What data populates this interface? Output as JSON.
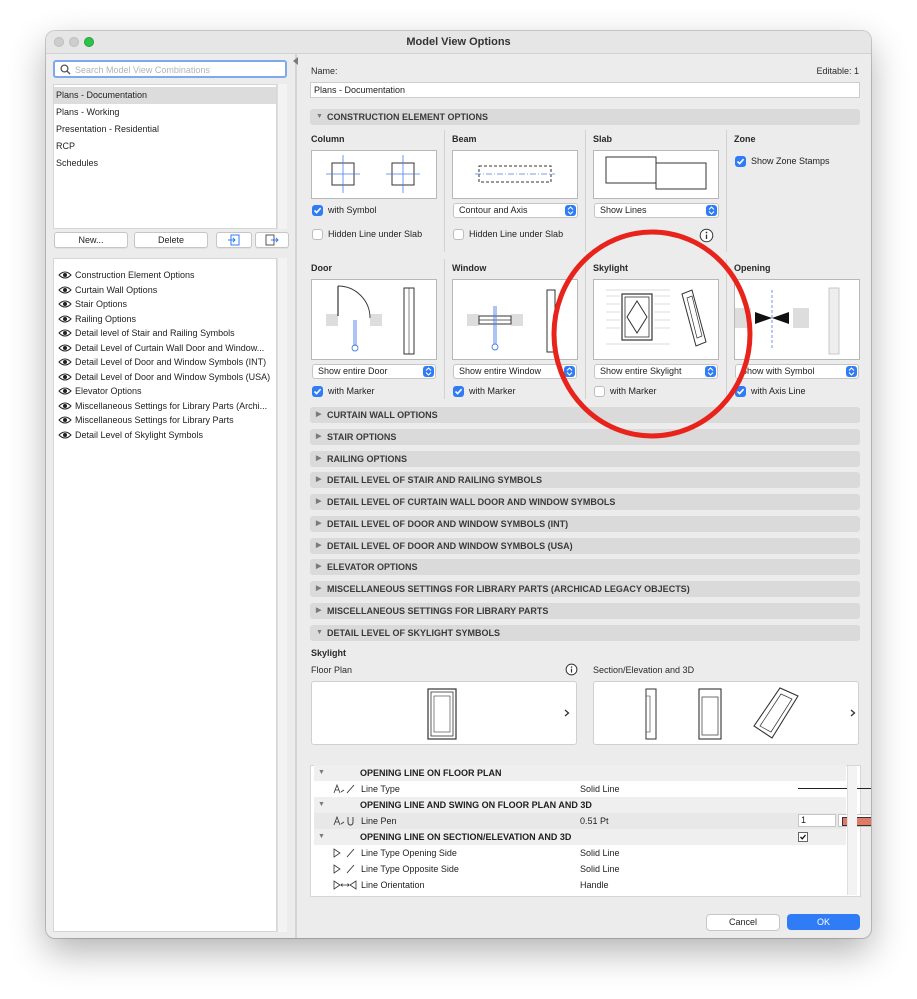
{
  "window": {
    "title": "Model View Options"
  },
  "sidebar": {
    "search_placeholder": "Search Model View Combinations",
    "combinations": [
      "Plans - Documentation",
      "Plans - Working",
      "Presentation - Residential",
      "RCP",
      "Schedules"
    ],
    "selected_combination": "Plans - Documentation",
    "buttons": {
      "new": "New...",
      "delete": "Delete"
    },
    "option_sets": [
      "Construction Element Options",
      "Curtain Wall Options",
      "Stair Options",
      "Railing Options",
      "Detail level of Stair and Railing Symbols",
      "Detail Level of Curtain Wall Door and Window...",
      "Detail Level of Door and Window Symbols (INT)",
      "Detail Level of Door and Window Symbols (USA)",
      "Elevator Options",
      "Miscellaneous Settings for Library Parts (Archi...",
      "Miscellaneous Settings for Library Parts",
      "Detail Level of Skylight Symbols"
    ]
  },
  "main": {
    "name_label": "Name:",
    "name_value": "Plans - Documentation",
    "editable": "Editable: 1",
    "construction": {
      "header": "CONSTRUCTION ELEMENT OPTIONS",
      "column": {
        "title": "Column",
        "check1": "with Symbol",
        "check2": "Hidden Line under Slab"
      },
      "beam": {
        "title": "Beam",
        "popup": "Contour and Axis",
        "check": "Hidden Line under Slab"
      },
      "slab": {
        "title": "Slab",
        "popup": "Show Lines",
        "info_icon": "info-icon"
      },
      "zone": {
        "title": "Zone",
        "check": "Show Zone Stamps"
      },
      "door": {
        "title": "Door",
        "popup": "Show entire Door",
        "check": "with Marker"
      },
      "window": {
        "title": "Window",
        "popup": "Show entire Window",
        "check": "with Marker"
      },
      "skylight": {
        "title": "Skylight",
        "popup": "Show entire Skylight",
        "check": "with Marker"
      },
      "opening": {
        "title": "Opening",
        "popup": "Show with Symbol",
        "check": "with Axis Line"
      }
    },
    "collapsed_sections": [
      "CURTAIN WALL OPTIONS",
      "STAIR OPTIONS",
      "RAILING OPTIONS",
      "DETAIL LEVEL OF STAIR AND RAILING SYMBOLS",
      "DETAIL LEVEL OF CURTAIN WALL DOOR AND WINDOW SYMBOLS",
      "DETAIL LEVEL OF DOOR AND WINDOW SYMBOLS (INT)",
      "DETAIL LEVEL OF DOOR AND WINDOW SYMBOLS (USA)",
      "ELEVATOR OPTIONS",
      "MISCELLANEOUS SETTINGS FOR LIBRARY PARTS (ARCHICAD LEGACY OBJECTS)",
      "MISCELLANEOUS SETTINGS FOR LIBRARY PARTS"
    ],
    "skylight_section": {
      "header": "DETAIL LEVEL OF SKYLIGHT SYMBOLS",
      "subtitle": "Skylight",
      "floor_plan_label": "Floor Plan",
      "section_label": "Section/Elevation and 3D"
    },
    "properties": {
      "groups": [
        {
          "title": "OPENING LINE ON FLOOR PLAN",
          "rows": [
            {
              "name": "Line Type",
              "value": "Solid Line"
            }
          ]
        },
        {
          "title": "OPENING LINE AND SWING ON FLOOR PLAN AND 3D",
          "rows": [
            {
              "name": "Line Pen",
              "value": "0.51 Pt",
              "pen_number": "1",
              "pen_color": "#e07a66"
            }
          ]
        },
        {
          "title": "OPENING LINE ON SECTION/ELEVATION AND 3D",
          "rows": [
            {
              "name": "Line Type Opening Side",
              "value": "Solid Line"
            },
            {
              "name": "Line Type Opposite Side",
              "value": "Solid Line"
            },
            {
              "name": "Line Orientation",
              "value": "Handle"
            }
          ]
        }
      ]
    },
    "buttons": {
      "cancel": "Cancel",
      "ok": "OK"
    }
  },
  "colors": {
    "accent": "#2f7cf6",
    "annotation": "#e8231b"
  }
}
